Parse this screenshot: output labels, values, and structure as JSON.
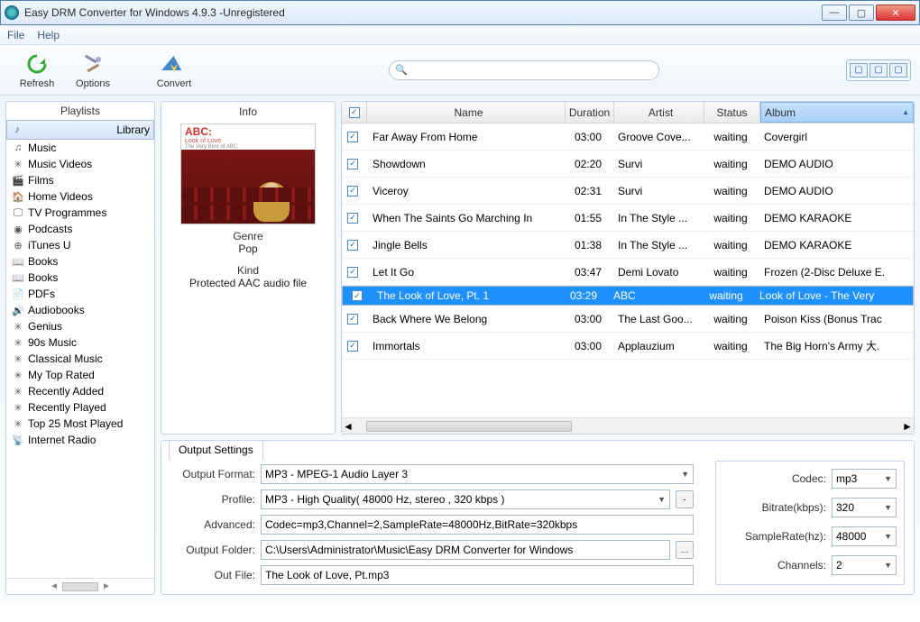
{
  "window": {
    "title": "Easy DRM Converter for Windows 4.9.3 -Unregistered"
  },
  "menu": {
    "file": "File",
    "help": "Help"
  },
  "toolbar": {
    "refresh": "Refresh",
    "options": "Options",
    "convert": "Convert",
    "search_placeholder": ""
  },
  "sidebar": {
    "header": "Playlists",
    "items": [
      {
        "icon": "♪",
        "label": "Library",
        "selected": true
      },
      {
        "icon": "♫",
        "label": "Music"
      },
      {
        "icon": "✳",
        "label": "Music Videos"
      },
      {
        "icon": "🎬",
        "label": "Films"
      },
      {
        "icon": "🏠",
        "label": "Home Videos"
      },
      {
        "icon": "🖵",
        "label": "TV Programmes"
      },
      {
        "icon": "◉",
        "label": "Podcasts"
      },
      {
        "icon": "⊕",
        "label": "iTunes U"
      },
      {
        "icon": "📖",
        "label": "Books"
      },
      {
        "icon": "📖",
        "label": "Books"
      },
      {
        "icon": "📄",
        "label": "PDFs"
      },
      {
        "icon": "🔊",
        "label": "Audiobooks"
      },
      {
        "icon": "✳",
        "label": "Genius"
      },
      {
        "icon": "✳",
        "label": "90s Music"
      },
      {
        "icon": "✳",
        "label": "Classical Music"
      },
      {
        "icon": "✳",
        "label": "My Top Rated"
      },
      {
        "icon": "✳",
        "label": "Recently Added"
      },
      {
        "icon": "✳",
        "label": "Recently Played"
      },
      {
        "icon": "✳",
        "label": "Top 25 Most Played"
      },
      {
        "icon": "📡",
        "label": "Internet Radio"
      }
    ]
  },
  "info": {
    "header": "Info",
    "art_title": "ABC:",
    "art_sub1": "Look of Love",
    "art_sub2": "The Very Best of ABC",
    "genre_label": "Genre",
    "genre_value": "Pop",
    "kind_label": "Kind",
    "kind_value": "Protected AAC audio file"
  },
  "tracks": {
    "header": {
      "chk": "✓",
      "name": "Name",
      "duration": "Duration",
      "artist": "Artist",
      "status": "Status",
      "album": "Album"
    },
    "rows": [
      {
        "name": "Far Away From Home",
        "dur": "03:00",
        "artist": "Groove Cove...",
        "status": "waiting",
        "album": "Covergirl"
      },
      {
        "name": "Showdown",
        "dur": "02:20",
        "artist": "Survi",
        "status": "waiting",
        "album": "DEMO AUDIO"
      },
      {
        "name": "Viceroy",
        "dur": "02:31",
        "artist": "Survi",
        "status": "waiting",
        "album": "DEMO AUDIO"
      },
      {
        "name": "When The Saints Go Marching In",
        "dur": "01:55",
        "artist": "In The Style ...",
        "status": "waiting",
        "album": "DEMO KARAOKE"
      },
      {
        "name": "Jingle Bells",
        "dur": "01:38",
        "artist": "In The Style ...",
        "status": "waiting",
        "album": "DEMO KARAOKE"
      },
      {
        "name": "Let It Go",
        "dur": "03:47",
        "artist": "Demi Lovato",
        "status": "waiting",
        "album": "Frozen (2-Disc Deluxe E."
      },
      {
        "name": "The Look of Love, Pt. 1",
        "dur": "03:29",
        "artist": "ABC",
        "status": "waiting",
        "album": "Look of Love - The Very",
        "selected": true
      },
      {
        "name": "Back Where We Belong",
        "dur": "03:00",
        "artist": "The Last Goo...",
        "status": "waiting",
        "album": "Poison Kiss (Bonus Trac"
      },
      {
        "name": "Immortals",
        "dur": "03:00",
        "artist": "Applauzium",
        "status": "waiting",
        "album": "The Big Horn's Army 大."
      }
    ]
  },
  "output": {
    "tab": "Output Settings",
    "format_label": "Output Format:",
    "format_value": "MP3 - MPEG-1 Audio Layer 3",
    "profile_label": "Profile:",
    "profile_value": "MP3 - High Quality( 48000 Hz, stereo , 320 kbps  )",
    "advanced_label": "Advanced:",
    "advanced_value": "Codec=mp3,Channel=2,SampleRate=48000Hz,BitRate=320kbps",
    "folder_label": "Output Folder:",
    "folder_value": "C:\\Users\\Administrator\\Music\\Easy DRM Converter for Windows",
    "outfile_label": "Out File:",
    "outfile_value": "The Look of Love, Pt.mp3",
    "codec_label": "Codec:",
    "codec_value": "mp3",
    "bitrate_label": "Bitrate(kbps):",
    "bitrate_value": "320",
    "samplerate_label": "SampleRate(hz):",
    "samplerate_value": "48000",
    "channels_label": "Channels:",
    "channels_value": "2"
  }
}
